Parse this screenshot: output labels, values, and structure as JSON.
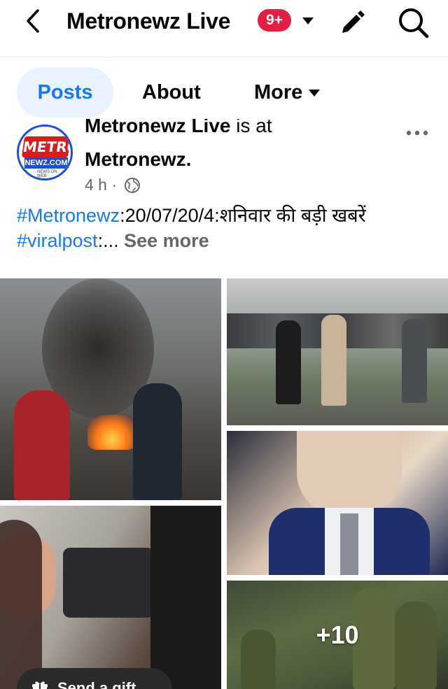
{
  "header": {
    "title": "Metronewz Live",
    "notification_count": "9+"
  },
  "tabs": [
    {
      "label": "Posts"
    },
    {
      "label": "About"
    },
    {
      "label": "More"
    }
  ],
  "post": {
    "author": "Metronewz Live",
    "is_at": "is at",
    "location": "Metronewz.",
    "time": "4 h",
    "separator": "·",
    "avatar": {
      "logo_top": "METRO",
      "logo_bottom": "NEWZ.COM",
      "logo_small": "NEWS ON WEB"
    },
    "text": {
      "hashtag1": "#Metronewz",
      "body": ":20/07/20/4:शनिवार की बड़ी खबरें ",
      "hashtag2": "#viralpost",
      "tail": ":... ",
      "see_more": "See more"
    },
    "photos": {
      "extra_count": "+10"
    }
  },
  "gift_button": {
    "label": "Send a gift"
  },
  "colors": {
    "accent": "#1877f2",
    "badge": "#e41e3f",
    "tab_active_bg": "#e7f3ff",
    "secondary_text": "#65676b"
  },
  "icons": {
    "back": "chevron-left-icon",
    "caret": "caret-down-icon",
    "edit": "pencil-icon",
    "search": "search-icon",
    "globe": "globe-icon",
    "more": "more-dots-icon",
    "gift": "gift-icon"
  }
}
